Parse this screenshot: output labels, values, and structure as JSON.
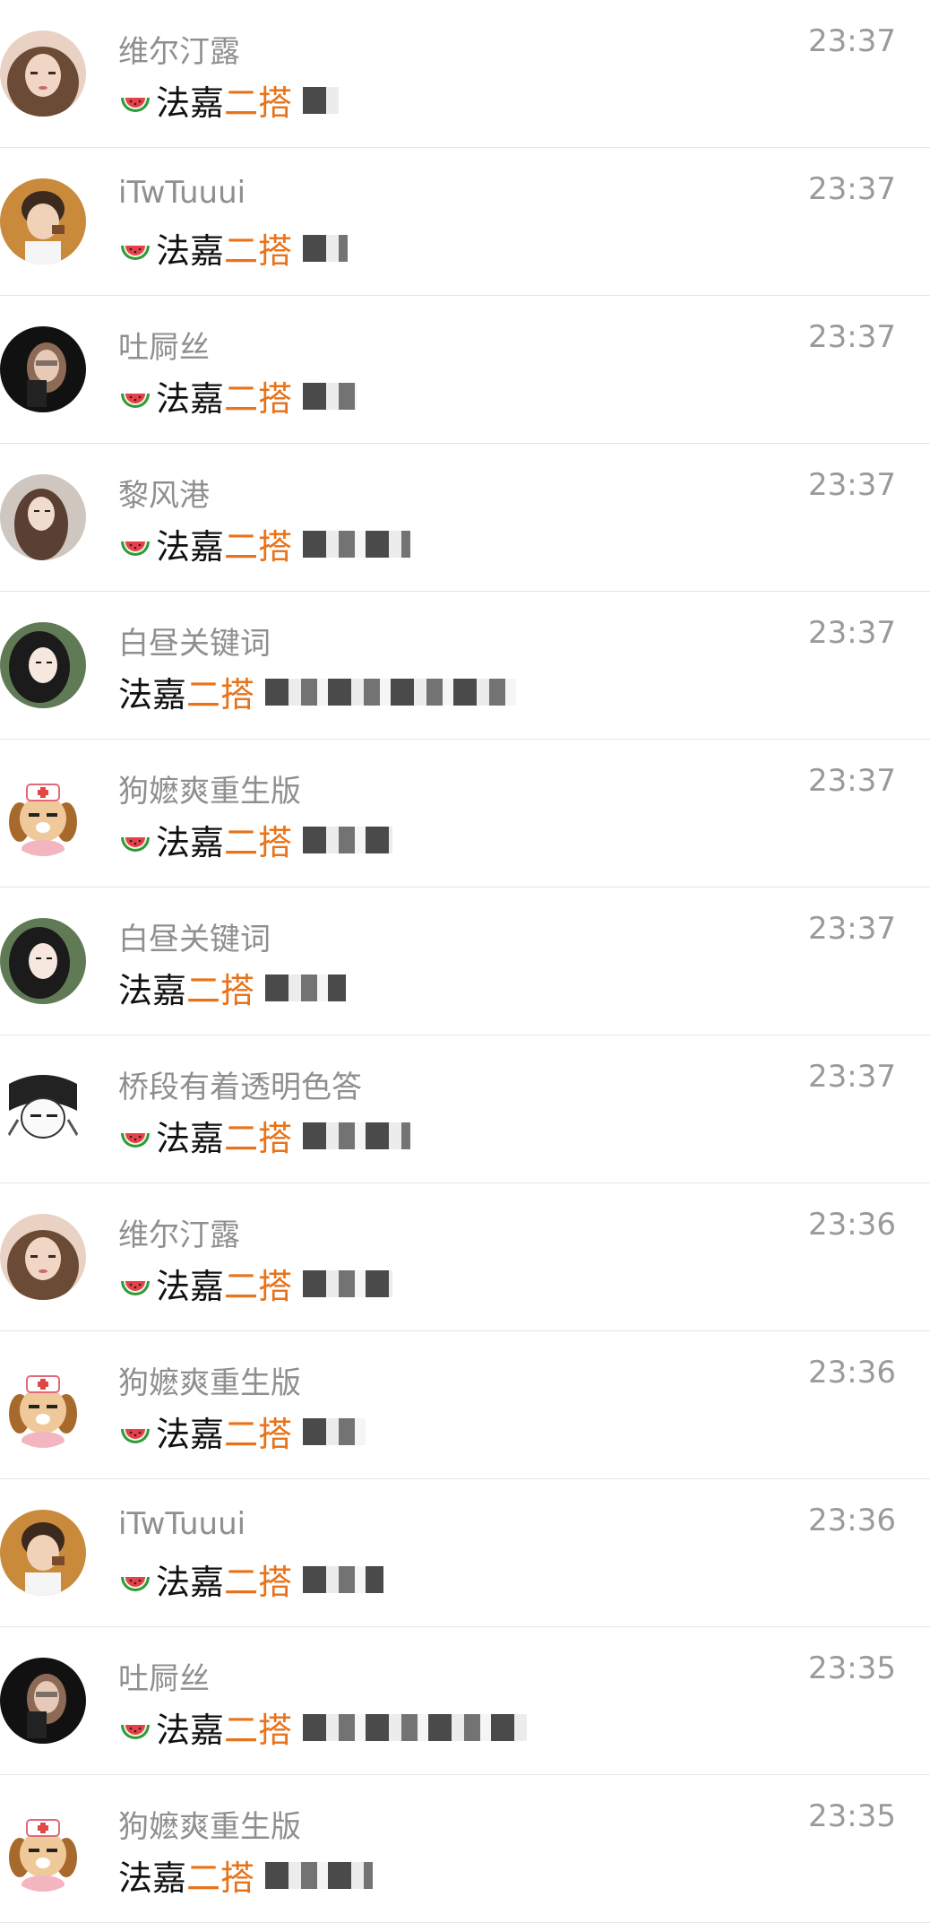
{
  "messages": [
    {
      "name": "维尔汀露",
      "time": "23:37",
      "emoji": true,
      "prefix": "法嘉",
      "keyword": "二搭",
      "tail": "",
      "avatar": "girl-a"
    },
    {
      "name": "iTwTuuui",
      "time": "23:37",
      "emoji": true,
      "prefix": "法嘉",
      "keyword": "二搭",
      "tail": "",
      "avatar": "boy"
    },
    {
      "name": "吐屙丝",
      "time": "23:37",
      "emoji": true,
      "prefix": "法嘉",
      "keyword": "二搭",
      "tail": "",
      "avatar": "girl-dark"
    },
    {
      "name": "黎风港",
      "time": "23:37",
      "emoji": true,
      "prefix": "法嘉",
      "keyword": "二搭",
      "tail": "",
      "avatar": "girl-b"
    },
    {
      "name": "白昼关键词",
      "time": "23:37",
      "emoji": false,
      "prefix": "法嘉",
      "keyword": "二搭",
      "tail": "",
      "avatar": "girl-c"
    },
    {
      "name": "狗嬷爽重生版",
      "time": "23:37",
      "emoji": true,
      "prefix": "法嘉",
      "keyword": "二搭",
      "tail": "",
      "avatar": "dog"
    },
    {
      "name": "白昼关键词",
      "time": "23:37",
      "emoji": false,
      "prefix": "法嘉",
      "keyword": "二搭",
      "tail": "",
      "avatar": "girl-c"
    },
    {
      "name": "桥段有着透明色答",
      "time": "23:37",
      "emoji": true,
      "prefix": "法嘉",
      "keyword": "二搭",
      "tail": "",
      "avatar": "sketch"
    },
    {
      "name": "维尔汀露",
      "time": "23:36",
      "emoji": true,
      "prefix": "法嘉",
      "keyword": "二搭",
      "tail": "",
      "avatar": "girl-a"
    },
    {
      "name": "狗嬷爽重生版",
      "time": "23:36",
      "emoji": true,
      "prefix": "法嘉",
      "keyword": "二搭",
      "tail": "",
      "avatar": "dog"
    },
    {
      "name": "iTwTuuui",
      "time": "23:36",
      "emoji": true,
      "prefix": "法嘉",
      "keyword": "二搭",
      "tail": "",
      "avatar": "boy"
    },
    {
      "name": "吐屙丝",
      "time": "23:35",
      "emoji": true,
      "prefix": "法嘉",
      "keyword": "二搭",
      "tail": "",
      "avatar": "girl-dark"
    },
    {
      "name": "狗嬷爽重生版",
      "time": "23:35",
      "emoji": false,
      "prefix": "法嘉",
      "keyword": "二搭",
      "tail": "",
      "avatar": "dog"
    }
  ],
  "colors": {
    "keyword": "#e8731a",
    "name": "#8f8f8f",
    "time": "#9a9a9a",
    "divider": "#e6e6e6"
  }
}
